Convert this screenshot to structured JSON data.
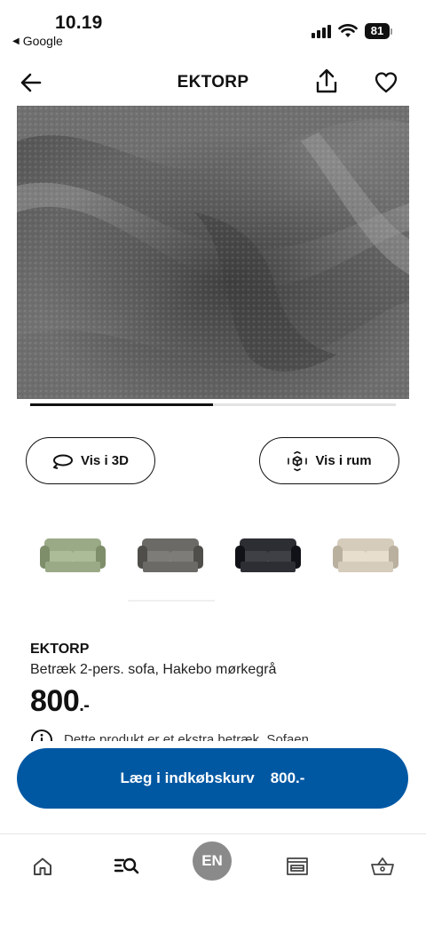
{
  "status_bar": {
    "time": "10.19",
    "back_app": "Google",
    "battery": "81"
  },
  "header": {
    "title": "EKTORP",
    "back_icon": "arrow-left-icon",
    "share_icon": "share-icon",
    "favorite_icon": "heart-icon"
  },
  "gallery": {
    "image_progress": 0.5
  },
  "buttons": {
    "view_3d": "Vis i 3D",
    "view_in_room": "Vis i rum"
  },
  "swatches": [
    {
      "color": "#9aaa86",
      "name": "green"
    },
    {
      "color": "#6b6a66",
      "name": "dark-grey"
    },
    {
      "color": "#2c2e33",
      "name": "black"
    },
    {
      "color": "#d6ccbb",
      "name": "beige"
    }
  ],
  "product": {
    "name": "EKTORP",
    "description": "Betræk 2-pers. sofa, Hakebo mørkegrå",
    "price": "800",
    "price_suffix": ".-",
    "info": "Dette produkt er et ekstra betræk. Sofaen"
  },
  "cta": {
    "label": "Læg i indkøbskurv",
    "price": "800.-",
    "color": "#0058a3"
  },
  "bottom_nav": {
    "avatar": "EN",
    "items": [
      "home-icon",
      "search-icon",
      "avatar",
      "store-icon",
      "basket-icon"
    ]
  }
}
